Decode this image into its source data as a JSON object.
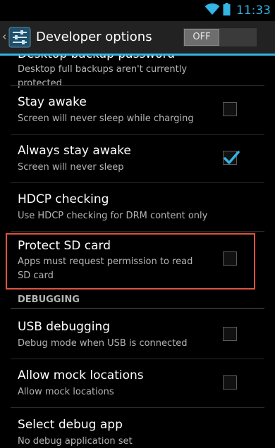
{
  "status_bar": {
    "time": "11:33",
    "accent": "#33b5e5",
    "icons": [
      "wifi-icon",
      "battery-icon"
    ]
  },
  "action_bar": {
    "title": "Developer options",
    "toggle_label": "OFF",
    "up_caret": "‹",
    "icon": "developer-settings-icon"
  },
  "settings": {
    "desktop_backup": {
      "title": "Desktop backup password",
      "summary": "Desktop full backups aren't currently protected"
    },
    "stay_awake": {
      "title": "Stay awake",
      "summary": "Screen will never sleep while charging",
      "checked": false
    },
    "always_stay_awake": {
      "title": "Always stay awake",
      "summary": "Screen will never sleep",
      "checked": true
    },
    "hdcp": {
      "title": "HDCP checking",
      "summary": "Use HDCP checking for DRM content only"
    },
    "protect_sd": {
      "title": "Protect SD card",
      "summary": "Apps must request permission to read SD card",
      "checked": false
    },
    "debugging_header": "DEBUGGING",
    "usb_debugging": {
      "title": "USB debugging",
      "summary": "Debug mode when USB is connected",
      "checked": false
    },
    "mock_locations": {
      "title": "Allow mock locations",
      "summary": "Allow mock locations",
      "checked": false
    },
    "debug_app": {
      "title": "Select debug app",
      "summary": "No debug application set"
    }
  },
  "colors": {
    "accent": "#33b5e5",
    "highlight": "#e0533c",
    "checkmark": "#33b5e5"
  }
}
